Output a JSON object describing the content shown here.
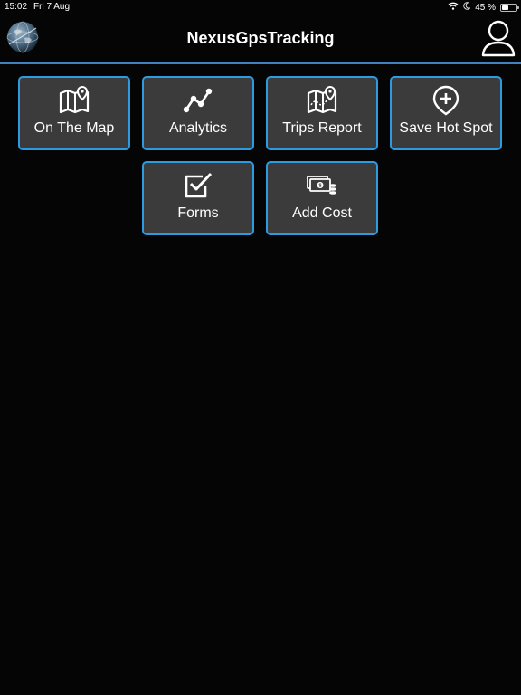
{
  "status_bar": {
    "time": "15:02",
    "date": "Fri 7 Aug",
    "battery_text": "45 %",
    "battery_level": 0.45,
    "wifi_icon": "wifi-icon",
    "moon_icon": "moon-icon"
  },
  "header": {
    "title": "NexusGpsTracking",
    "logo_icon": "globe-logo-icon",
    "profile_icon": "user-profile-icon"
  },
  "colors": {
    "background": "#050505",
    "tile_background": "#3b3b3b",
    "tile_border": "#2c9be0",
    "divider": "#3f84c0",
    "text": "#ffffff"
  },
  "menu": {
    "tiles": [
      {
        "label": "On The Map",
        "icon": "map-pin-icon"
      },
      {
        "label": "Analytics",
        "icon": "analytics-line-icon"
      },
      {
        "label": "Trips Report",
        "icon": "trip-map-icon"
      },
      {
        "label": "Save Hot Spot",
        "icon": "add-location-icon"
      },
      {
        "label": "Forms",
        "icon": "checkbox-icon"
      },
      {
        "label": "Add Cost",
        "icon": "money-coins-icon"
      }
    ]
  }
}
